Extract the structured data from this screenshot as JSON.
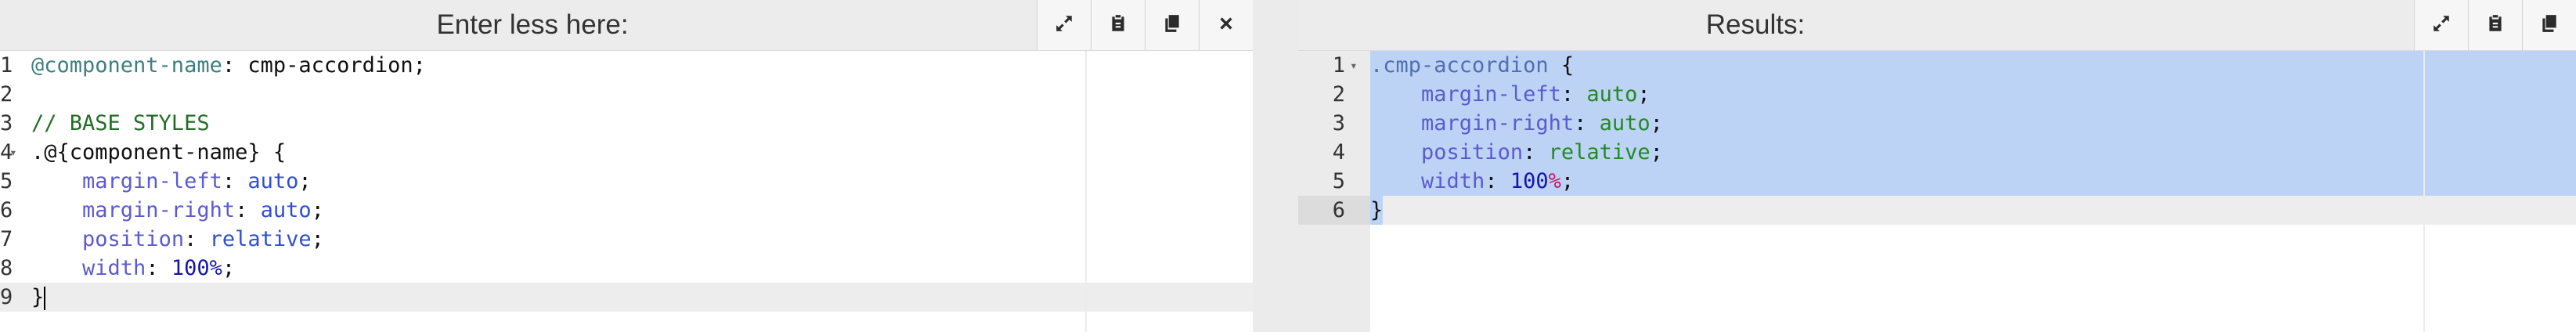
{
  "left_panel": {
    "title": "Enter less here:",
    "tools": [
      "expand-icon",
      "paste-icon",
      "copy-icon",
      "close-icon"
    ],
    "lines": [
      {
        "num": "1",
        "parts": [
          {
            "t": "@component-name",
            "c": "kw-var"
          },
          {
            "t": ": cmp-accordion;",
            "c": ""
          }
        ]
      },
      {
        "num": "2",
        "parts": []
      },
      {
        "num": "3",
        "parts": [
          {
            "t": "// BASE STYLES",
            "c": "kw-comment"
          }
        ]
      },
      {
        "num": "4",
        "fold": "▾",
        "parts": [
          {
            "t": ".@{component-name} {",
            "c": ""
          }
        ]
      },
      {
        "num": "5",
        "parts": [
          {
            "t": "    ",
            "c": ""
          },
          {
            "t": "margin-left",
            "c": "kw-prop"
          },
          {
            "t": ": ",
            "c": ""
          },
          {
            "t": "auto",
            "c": "kw-val"
          },
          {
            "t": ";",
            "c": ""
          }
        ]
      },
      {
        "num": "6",
        "parts": [
          {
            "t": "    ",
            "c": ""
          },
          {
            "t": "margin-right",
            "c": "kw-prop"
          },
          {
            "t": ": ",
            "c": ""
          },
          {
            "t": "auto",
            "c": "kw-val"
          },
          {
            "t": ";",
            "c": ""
          }
        ]
      },
      {
        "num": "7",
        "parts": [
          {
            "t": "    ",
            "c": ""
          },
          {
            "t": "position",
            "c": "kw-prop"
          },
          {
            "t": ": ",
            "c": ""
          },
          {
            "t": "relative",
            "c": "kw-val"
          },
          {
            "t": ";",
            "c": ""
          }
        ]
      },
      {
        "num": "8",
        "parts": [
          {
            "t": "    ",
            "c": ""
          },
          {
            "t": "width",
            "c": "kw-prop"
          },
          {
            "t": ": ",
            "c": ""
          },
          {
            "t": "100%",
            "c": "kw-num"
          },
          {
            "t": ";",
            "c": ""
          }
        ]
      },
      {
        "num": "9",
        "parts": [
          {
            "t": "}",
            "c": ""
          }
        ],
        "active": true,
        "cursor": true
      }
    ]
  },
  "right_panel": {
    "title": "Results:",
    "tools": [
      "expand-icon",
      "paste-icon",
      "copy-icon"
    ],
    "lines": [
      {
        "num": "1",
        "fold": "▾",
        "parts": [
          {
            "t": ".cmp-accordion",
            "c": "kw-sel"
          },
          {
            "t": " {",
            "c": ""
          }
        ],
        "selected": true
      },
      {
        "num": "2",
        "parts": [
          {
            "t": "    ",
            "c": ""
          },
          {
            "t": "margin-left",
            "c": "kw-prop"
          },
          {
            "t": ": ",
            "c": ""
          },
          {
            "t": "auto",
            "c": "kw-val-green"
          },
          {
            "t": ";",
            "c": ""
          }
        ],
        "selected": true
      },
      {
        "num": "3",
        "parts": [
          {
            "t": "    ",
            "c": ""
          },
          {
            "t": "margin-right",
            "c": "kw-prop"
          },
          {
            "t": ": ",
            "c": ""
          },
          {
            "t": "auto",
            "c": "kw-val-green"
          },
          {
            "t": ";",
            "c": ""
          }
        ],
        "selected": true
      },
      {
        "num": "4",
        "parts": [
          {
            "t": "    ",
            "c": ""
          },
          {
            "t": "position",
            "c": "kw-prop"
          },
          {
            "t": ": ",
            "c": ""
          },
          {
            "t": "relative",
            "c": "kw-val-green"
          },
          {
            "t": ";",
            "c": ""
          }
        ],
        "selected": true
      },
      {
        "num": "5",
        "parts": [
          {
            "t": "    ",
            "c": ""
          },
          {
            "t": "width",
            "c": "kw-prop"
          },
          {
            "t": ": ",
            "c": ""
          },
          {
            "t": "100",
            "c": "kw-num"
          },
          {
            "t": "%",
            "c": "kw-unit"
          },
          {
            "t": ";",
            "c": ""
          }
        ],
        "selected": true
      },
      {
        "num": "6",
        "parts": [
          {
            "t": "}",
            "c": ""
          }
        ],
        "selected_partial": true,
        "active": true
      }
    ]
  },
  "colors": {
    "header_bg": "#ececec",
    "selection": "#bdd3f6",
    "gutter": "#ebebeb"
  }
}
